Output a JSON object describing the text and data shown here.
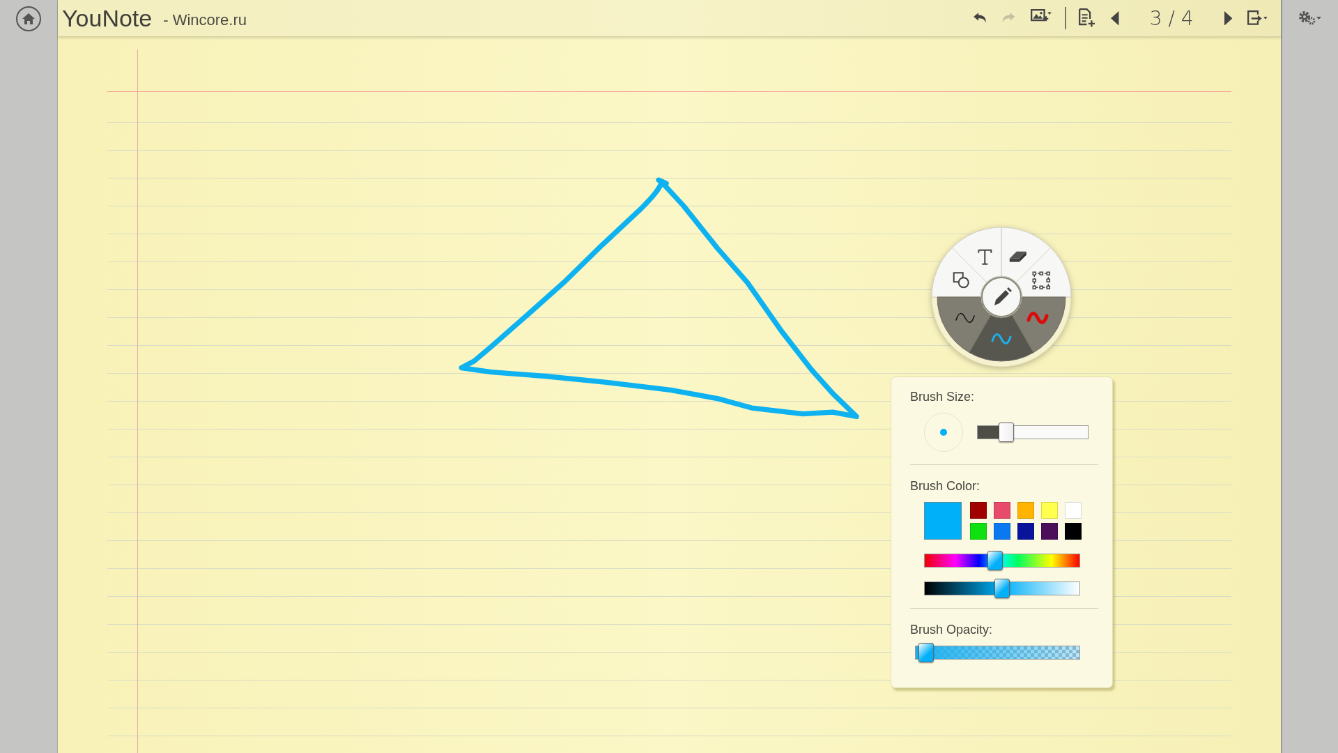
{
  "header": {
    "title": "YouNote",
    "subtitle": "- Wincore.ru"
  },
  "toolbar": {
    "edit": [
      {
        "kind": "undo",
        "disabled": false
      },
      {
        "kind": "redo",
        "disabled": true
      },
      {
        "kind": "insert-image",
        "disabled": false
      }
    ],
    "pages": [
      {
        "kind": "add-page",
        "disabled": false
      },
      {
        "kind": "previous",
        "disabled": false
      },
      {
        "kind": "page-number",
        "text": "3 / 4",
        "disabled": false
      },
      {
        "kind": "next",
        "disabled": false
      },
      {
        "kind": "export",
        "disabled": false
      }
    ]
  },
  "radial_menu": {
    "tools": [
      {
        "kind": "shapes"
      },
      {
        "kind": "text"
      },
      {
        "kind": "eraser"
      },
      {
        "kind": "select"
      }
    ],
    "brushes": [
      {
        "kind": "thin",
        "color": "#111111",
        "selected": false
      },
      {
        "kind": "medium",
        "color": "#1ab0ee",
        "selected": true
      },
      {
        "kind": "thick",
        "color": "#dd0a0a",
        "selected": false
      }
    ]
  },
  "brush_panel": {
    "size_label": "Brush Size:",
    "size_slider": {
      "level": 0.22
    },
    "color_label": "Brush Color:",
    "current_swatch": {
      "color": "#00b0f8"
    },
    "palette": [
      {
        "color": "#a00000"
      },
      {
        "color": "#e84a6c"
      },
      {
        "color": "#ffb400"
      },
      {
        "color": "#ffff50"
      },
      {
        "color": "#ffffff"
      },
      {
        "color": "#10e010"
      },
      {
        "color": "#0a78f0"
      },
      {
        "color": "#0a149a"
      },
      {
        "color": "#4a0e5a"
      },
      {
        "color": "#000000"
      }
    ],
    "hue_slider": {
      "level": 0.45
    },
    "brightness_slider": {
      "level": 0.5
    },
    "opacity_label": "Brush Opacity:",
    "opacity_slider": {
      "level": 0.02
    }
  }
}
